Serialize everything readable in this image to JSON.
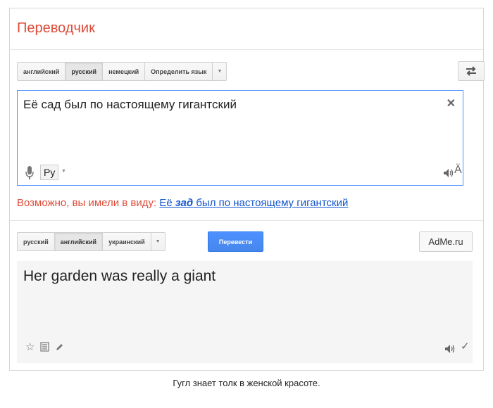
{
  "app": {
    "title": "Переводчик"
  },
  "source_langs": [
    "английский",
    "русский",
    "немецкий",
    "Определить язык"
  ],
  "source_active": 1,
  "source": {
    "text": "Её сад был по настоящему гигантский",
    "lang_chip": "Ру",
    "keyboard_glyph": "Ä"
  },
  "suggestion": {
    "prefix": "Возможно, вы имели в виду:",
    "link_before": "Её ",
    "link_bold": "зад",
    "link_after": " был по настоящему гигантский"
  },
  "target_langs": [
    "русский",
    "английский",
    "украинский"
  ],
  "target_active": 1,
  "translate_label": "Перевести",
  "adme_label": "AdMe.ru",
  "result": {
    "text": "Her garden was really a giant"
  },
  "caption": "Гугл знает толк в женской красоте."
}
